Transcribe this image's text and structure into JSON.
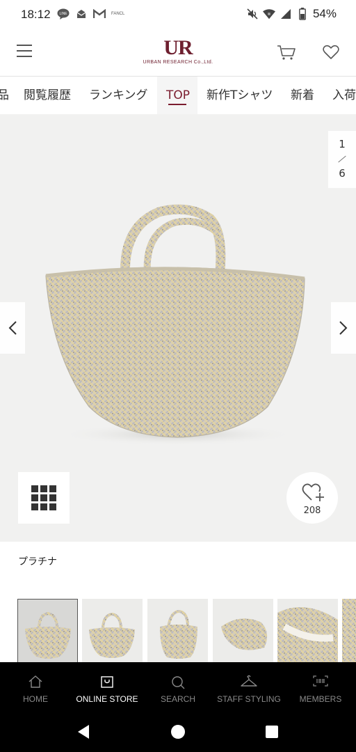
{
  "status": {
    "time": "18:12",
    "battery": "54%",
    "fancl_label": "FANCL"
  },
  "header": {
    "logo_mark": "UR",
    "logo_sub": "URBAN RESEARCH Co.,Ltd.",
    "brand_color": "#6e1f2f"
  },
  "tabs": [
    {
      "label": "品"
    },
    {
      "label": "閲覧履歴"
    },
    {
      "label": "ランキング"
    },
    {
      "label": "TOP"
    },
    {
      "label": "新作Tシャツ"
    },
    {
      "label": "新着"
    },
    {
      "label": "入荷"
    }
  ],
  "active_tab": "TOP",
  "gallery": {
    "current": "1",
    "total": "6",
    "like_count": "208"
  },
  "product": {
    "color_name": "プラチナ"
  },
  "thumbnails": [
    {
      "icon": "basket-front",
      "selected": true
    },
    {
      "icon": "basket-front",
      "selected": false
    },
    {
      "icon": "basket-side",
      "selected": false
    },
    {
      "icon": "basket-lying",
      "selected": false
    },
    {
      "icon": "basket-inside",
      "selected": false
    },
    {
      "icon": "basket-partial",
      "selected": false
    }
  ],
  "bottom_nav": [
    {
      "label": "HOME",
      "icon": "home-icon"
    },
    {
      "label": "ONLINE STORE",
      "icon": "bag-icon"
    },
    {
      "label": "SEARCH",
      "icon": "search-icon"
    },
    {
      "label": "STAFF STYLING",
      "icon": "hanger-icon"
    },
    {
      "label": "MEMBERS",
      "icon": "barcode-icon"
    }
  ],
  "active_nav": "ONLINE STORE"
}
